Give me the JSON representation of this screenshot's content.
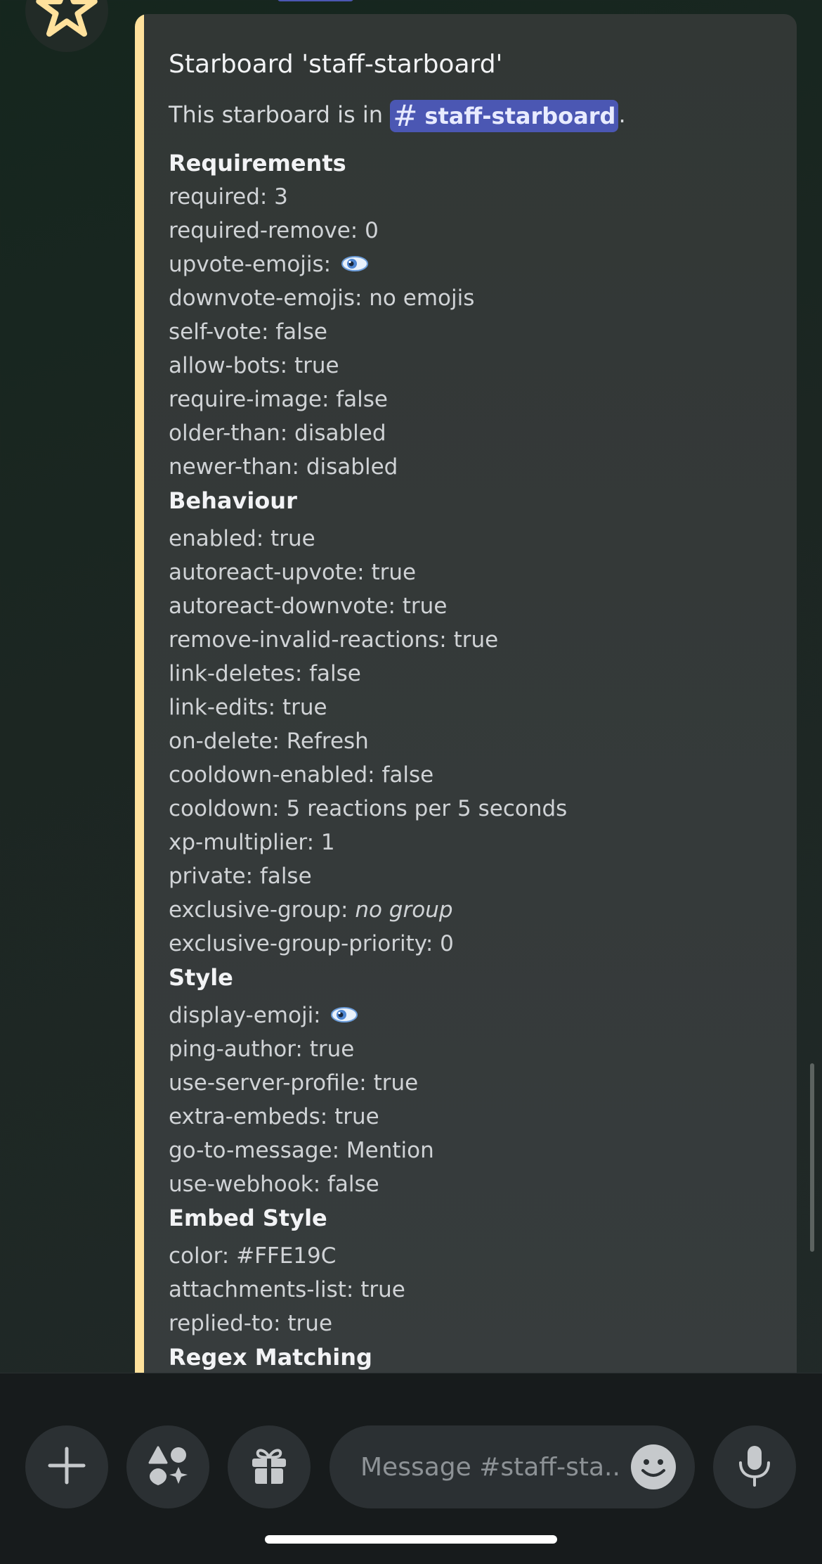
{
  "embed": {
    "title": "Starboard 'staff-starboard'",
    "accent_color": "#FFE19C",
    "description_prefix": "This starboard is in ",
    "channel_mention": "staff-starboard",
    "description_suffix": "."
  },
  "sections": {
    "requirements": {
      "title": "Requirements",
      "rows": [
        "required: 3",
        "required-remove: 0",
        "upvote-emojis:",
        "downvote-emojis: no emojis",
        "self-vote: false",
        "allow-bots: true",
        "require-image: false",
        "older-than: disabled",
        "newer-than: disabled"
      ]
    },
    "behaviour": {
      "title": "Behaviour",
      "rows": [
        "enabled: true",
        "autoreact-upvote: true",
        "autoreact-downvote: true",
        "remove-invalid-reactions: true",
        "link-deletes: false",
        "link-edits: true",
        "on-delete: Refresh",
        "cooldown-enabled: false",
        "cooldown: 5 reactions per 5 seconds",
        "xp-multiplier: 1",
        "private: false",
        "exclusive-group:",
        "exclusive-group-priority: 0"
      ],
      "exclusive_group_value": "no group"
    },
    "style": {
      "title": "Style",
      "rows": [
        "display-emoji:",
        "ping-author: true",
        "use-server-profile: true",
        "extra-embeds: true",
        "go-to-message: Mention",
        "use-webhook: false"
      ]
    },
    "embed_style": {
      "title": "Embed Style",
      "rows": [
        "color: #FFE19C",
        "attachments-list: true",
        "replied-to: true"
      ]
    },
    "regex_matching": {
      "title": "Regex Matching"
    }
  },
  "icons": {
    "avatar": "star-icon",
    "upvote_emoji": "eye-emoji",
    "display_emoji": "eye-emoji"
  },
  "composer": {
    "placeholder": "Message #staff-sta..",
    "buttons": [
      "plus-icon",
      "apps-icon",
      "gift-icon",
      "emoji-icon",
      "microphone-icon"
    ]
  },
  "colors": {
    "mention_bg": "#4B57B3",
    "embed_bg": "#343938",
    "bottom_bar": "#171B1C"
  }
}
